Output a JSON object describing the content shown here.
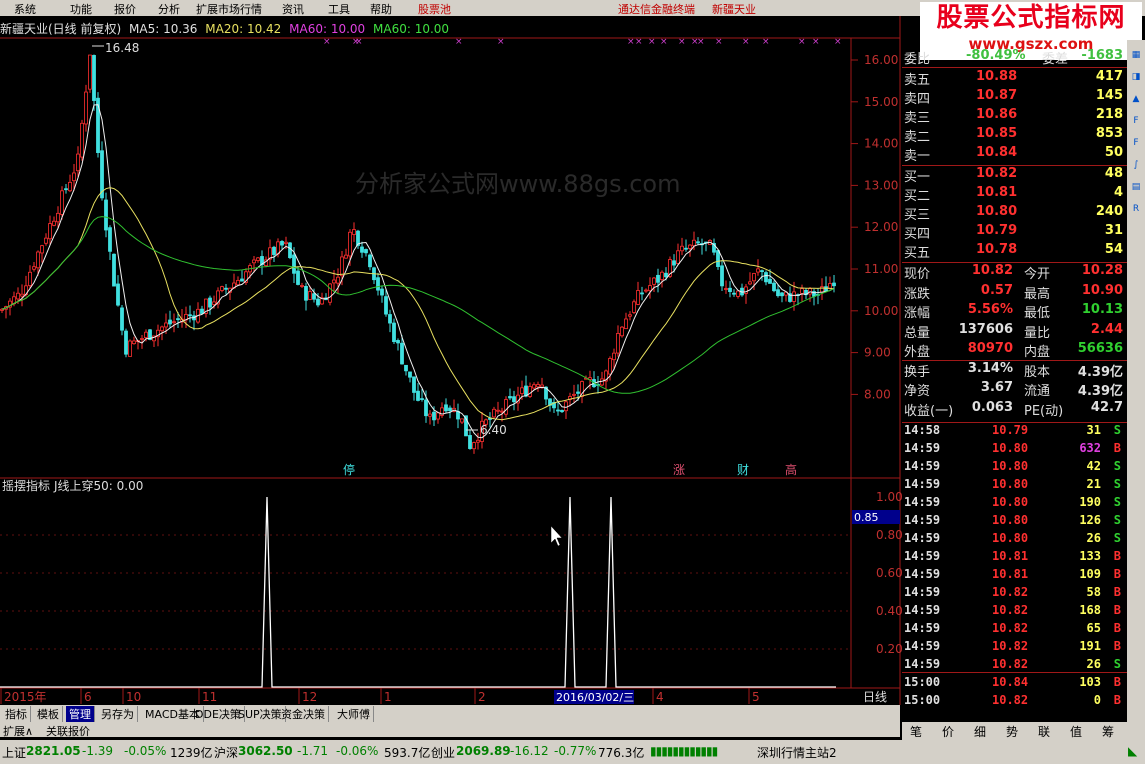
{
  "menu": [
    "系统",
    "功能",
    "报价",
    "分析",
    "扩展市场行情",
    "资讯",
    "工具",
    "帮助",
    "股票池",
    "通达信金融终端",
    "新疆天业"
  ],
  "header": {
    "stock": "新疆天业(日线 前复权)",
    "ma5": "MA5: 10.36",
    "ma20": "MA20: 10.42",
    "ma60a": "MA60: 10.00",
    "ma60b": "MA60: 10.00"
  },
  "watermark": {
    "title": "股票公式指标网",
    "url": "www.gszx.com"
  },
  "center_watermark": "分析家公式网www.88gs.com",
  "price_axis": [
    "16.00",
    "15.00",
    "14.00",
    "13.00",
    "12.00",
    "11.00",
    "10.00",
    "9.00",
    "8.00"
  ],
  "annotations": {
    "high": "16.48",
    "low": "6.40",
    "ting": "停",
    "zhang": "涨",
    "cai": "财",
    "gao": "高"
  },
  "indicator": {
    "title": "摇摆指标",
    "line_label": "J线上穿50: 0.00",
    "axis": [
      "1.00",
      "0.80",
      "0.60",
      "0.40",
      "0.20"
    ],
    "current": "0.85"
  },
  "date_axis": {
    "labels": [
      "2015年",
      "6",
      "10",
      "11",
      "12",
      "1",
      "2",
      "4",
      "5"
    ],
    "cursor_date": "2016/03/02/三",
    "period": "日线"
  },
  "bottom_tabs": [
    "指标",
    "模板",
    "管理",
    "另存为",
    "MACD基本",
    "DDE决策",
    "SUP决策",
    "资金决策",
    "大师傅"
  ],
  "bottom_tabs2": [
    "扩展∧",
    "关联报价"
  ],
  "orderbook": {
    "header": {
      "label": "委比",
      "value": "-80.49%",
      "label2": "委差",
      "value2": "-1683"
    },
    "asks": [
      {
        "label": "卖五",
        "price": "10.88",
        "vol": "417"
      },
      {
        "label": "卖四",
        "price": "10.87",
        "vol": "145"
      },
      {
        "label": "卖三",
        "price": "10.86",
        "vol": "218"
      },
      {
        "label": "卖二",
        "price": "10.85",
        "vol": "853"
      },
      {
        "label": "卖一",
        "price": "10.84",
        "vol": "50"
      }
    ],
    "bids": [
      {
        "label": "买一",
        "price": "10.82",
        "vol": "48"
      },
      {
        "label": "买二",
        "price": "10.81",
        "vol": "4"
      },
      {
        "label": "买三",
        "price": "10.80",
        "vol": "240"
      },
      {
        "label": "买四",
        "price": "10.79",
        "vol": "31"
      },
      {
        "label": "买五",
        "price": "10.78",
        "vol": "54"
      }
    ]
  },
  "stats": [
    {
      "l1": "现价",
      "v1": "10.82",
      "l2": "今开",
      "v2": "10.28",
      "c1": "up",
      "c2": "up"
    },
    {
      "l1": "涨跌",
      "v1": "0.57",
      "l2": "最高",
      "v2": "10.90",
      "c1": "up",
      "c2": "up"
    },
    {
      "l1": "涨幅",
      "v1": "5.56%",
      "l2": "最低",
      "v2": "10.13",
      "c1": "up",
      "c2": "dn"
    },
    {
      "l1": "总量",
      "v1": "137606",
      "l2": "量比",
      "v2": "2.44",
      "c1": "wh",
      "c2": "up"
    },
    {
      "l1": "外盘",
      "v1": "80970",
      "l2": "内盘",
      "v2": "56636",
      "c1": "up",
      "c2": "dn"
    },
    {
      "l1": "换手",
      "v1": "3.14%",
      "l2": "股本",
      "v2": "4.39亿",
      "c1": "wh",
      "c2": "wh"
    },
    {
      "l1": "净资",
      "v1": "3.67",
      "l2": "流通",
      "v2": "4.39亿",
      "c1": "wh",
      "c2": "wh"
    },
    {
      "l1": "收益(一)",
      "v1": "0.063",
      "l2": "PE(动)",
      "v2": "42.7",
      "c1": "wh",
      "c2": "wh"
    }
  ],
  "ticks": [
    {
      "t": "14:58",
      "p": "10.79",
      "v": "31",
      "s": "S"
    },
    {
      "t": "14:59",
      "p": "10.80",
      "v": "632",
      "s": "B"
    },
    {
      "t": "14:59",
      "p": "10.80",
      "v": "42",
      "s": "S"
    },
    {
      "t": "14:59",
      "p": "10.80",
      "v": "21",
      "s": "S"
    },
    {
      "t": "14:59",
      "p": "10.80",
      "v": "190",
      "s": "S"
    },
    {
      "t": "14:59",
      "p": "10.80",
      "v": "126",
      "s": "S"
    },
    {
      "t": "14:59",
      "p": "10.80",
      "v": "26",
      "s": "S"
    },
    {
      "t": "14:59",
      "p": "10.81",
      "v": "133",
      "s": "B"
    },
    {
      "t": "14:59",
      "p": "10.81",
      "v": "109",
      "s": "B"
    },
    {
      "t": "14:59",
      "p": "10.82",
      "v": "58",
      "s": "B"
    },
    {
      "t": "14:59",
      "p": "10.82",
      "v": "168",
      "s": "B"
    },
    {
      "t": "14:59",
      "p": "10.82",
      "v": "65",
      "s": "B"
    },
    {
      "t": "14:59",
      "p": "10.82",
      "v": "191",
      "s": "B"
    },
    {
      "t": "14:59",
      "p": "10.82",
      "v": "26",
      "s": "S"
    },
    {
      "t": "15:00",
      "p": "10.84",
      "v": "103",
      "s": "B"
    },
    {
      "t": "15:00",
      "p": "10.82",
      "v": "0",
      "s": "B"
    }
  ],
  "right_tabs": [
    "笔",
    "价",
    "细",
    "势",
    "联",
    "值",
    "筹"
  ],
  "right_icons": [
    "rt-icon",
    "chart-icon",
    "up-icon",
    "fi-icon",
    "f10-icon",
    "fx-icon",
    "pr-icon",
    "rsi-icon"
  ],
  "status_bar": {
    "sh": {
      "name": "上证",
      "val": "2821.05",
      "chg": "-1.39",
      "pct": "-0.05%",
      "amt": "1239亿"
    },
    "sz": {
      "name": "沪深",
      "val": "3062.50",
      "chg": "-1.71",
      "pct": "-0.06%",
      "amt": "593.7亿"
    },
    "cy": {
      "name": "创业",
      "val": "2069.89",
      "chg": "-16.12",
      "pct": "-0.77%",
      "amt": "776.3亿"
    },
    "server": "深圳行情主站2"
  }
}
